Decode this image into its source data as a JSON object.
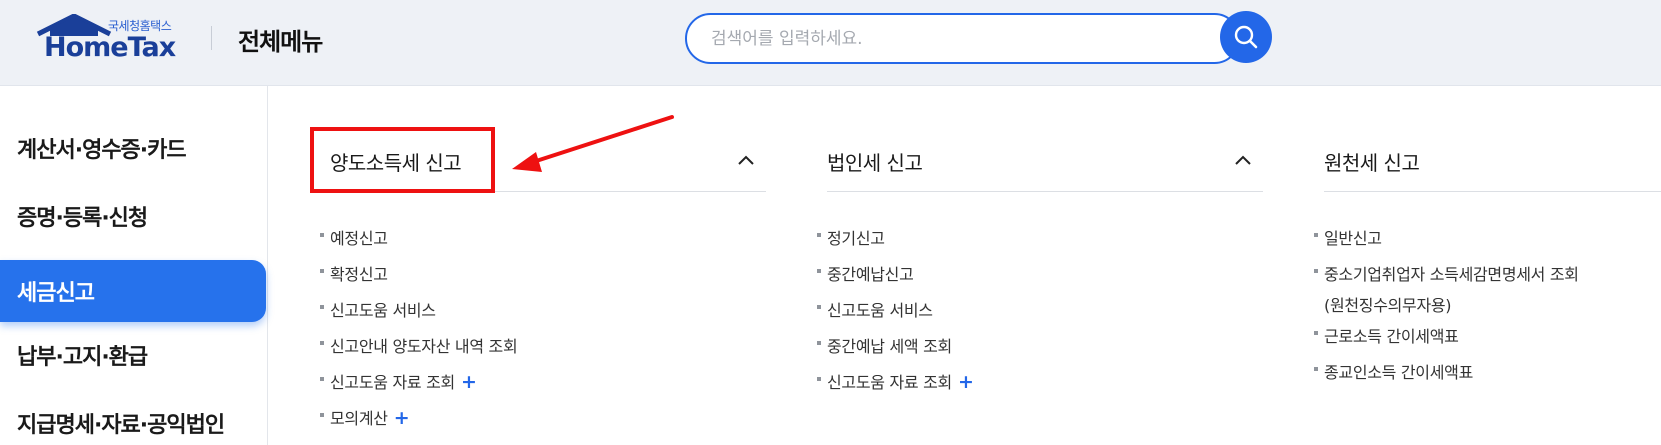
{
  "header": {
    "logo_sub": "국세청홈택스",
    "logo_main": "HomeTax",
    "page_title": "전체메뉴",
    "search_placeholder": "검색어를 입력하세요."
  },
  "sidebar": {
    "items": [
      {
        "label": "계산서·영수증·카드",
        "active": false
      },
      {
        "label": "증명·등록·신청",
        "active": false
      },
      {
        "label": "세금신고",
        "active": true
      },
      {
        "label": "납부·고지·환급",
        "active": false
      },
      {
        "label": "지급명세·자료·공익법인",
        "active": false
      }
    ]
  },
  "columns": [
    {
      "title": "양도소득세 신고",
      "items": [
        {
          "label": "예정신고"
        },
        {
          "label": "확정신고"
        },
        {
          "label": "신고도움 서비스"
        },
        {
          "label": "신고안내 양도자산 내역 조회"
        },
        {
          "label": "신고도움 자료 조회",
          "expand": "+"
        },
        {
          "label": "모의계산",
          "expand": "+"
        }
      ]
    },
    {
      "title": "법인세 신고",
      "items": [
        {
          "label": "정기신고"
        },
        {
          "label": "중간예납신고"
        },
        {
          "label": "신고도움 서비스"
        },
        {
          "label": "중간예납 세액 조회"
        },
        {
          "label": "신고도움 자료 조회",
          "expand": "+"
        }
      ]
    },
    {
      "title": "원천세 신고",
      "items": [
        {
          "label": "일반신고"
        },
        {
          "label": "중소기업취업자 소득세감면명세서 조회",
          "label2": "(원천징수의무자용)"
        },
        {
          "label": "근로소득 간이세액표"
        },
        {
          "label": "종교인소득 간이세액표"
        }
      ]
    }
  ],
  "colors": {
    "accent": "#2367e8",
    "active_menu": "#2672ec",
    "annotation": "#ee1111"
  },
  "icons": {
    "search": "search-icon",
    "collapse": "chevron-up-icon",
    "logo_house": "house-icon"
  }
}
